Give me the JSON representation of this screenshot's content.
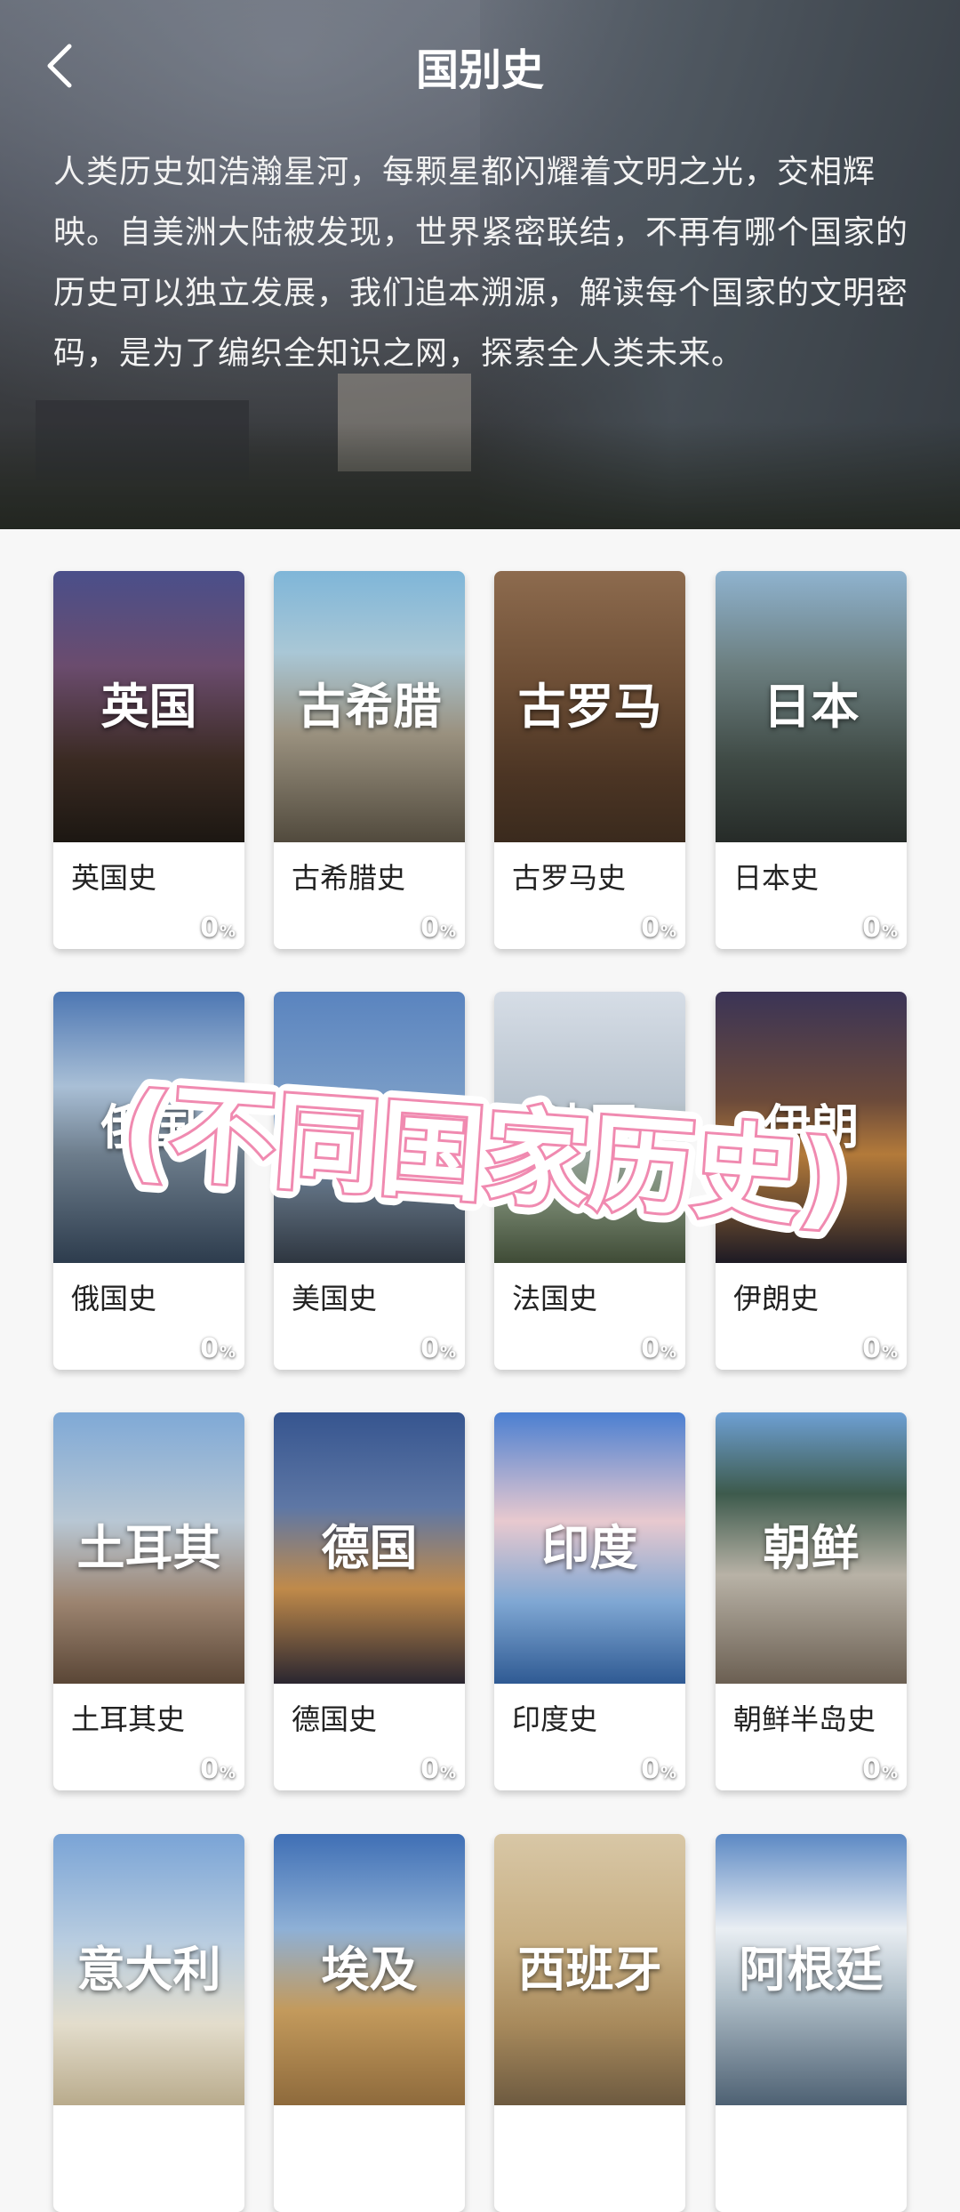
{
  "header": {
    "title": "国别史",
    "intro": "人类历史如浩瀚星河，每颗星都闪耀着文明之光，交相辉映。自美洲大陆被发现，世界紧密联结，不再有哪个国家的历史可以独立发展，我们追本溯源，解读每个国家的文明密码，是为了编织全知识之网，探索全人类未来。"
  },
  "cards": [
    {
      "img_name": "英国",
      "label": "英国史",
      "progress": "0",
      "unit": "%",
      "bg": "linear-gradient(180deg,#4a4f8a 0%,#6b4c6e 35%,#3a2a22 70%,#1c1712 100%)"
    },
    {
      "img_name": "古希腊",
      "label": "古希腊史",
      "progress": "0",
      "unit": "%",
      "bg": "linear-gradient(180deg,#7fb6d8 0%,#a9c7d6 30%,#9a917f 60%,#514a3d 100%)"
    },
    {
      "img_name": "古罗马",
      "label": "古罗马史",
      "progress": "0",
      "unit": "%",
      "bg": "linear-gradient(180deg,#8d6b4e 0%,#6e4f36 40%,#4c3524 75%,#3a2a1d 100%)"
    },
    {
      "img_name": "日本",
      "label": "日本史",
      "progress": "0",
      "unit": "%",
      "bg": "linear-gradient(180deg,#8fb3cf 0%,#6c7f80 35%,#3f4a45 70%,#262b28 100%)"
    },
    {
      "img_name": "俄国",
      "label": "俄国史",
      "progress": "0",
      "unit": "%",
      "bg": "linear-gradient(180deg,#4d77b3 0%,#a9bfd6 35%,#6d7d8c 60%,#2d3c4d 100%)"
    },
    {
      "img_name": "美国",
      "label": "美国史",
      "progress": "0",
      "unit": "%",
      "bg": "linear-gradient(180deg,#5a84bf 0%,#7ea0c8 45%,#5b6a7a 75%,#2e3640 100%)"
    },
    {
      "img_name": "法国",
      "label": "法国史",
      "progress": "0",
      "unit": "%",
      "bg": "linear-gradient(180deg,#d6dde6 0%,#b9c4cf 40%,#7a8a73 75%,#3f4b36 100%)"
    },
    {
      "img_name": "伊朗",
      "label": "伊朗史",
      "progress": "0",
      "unit": "%",
      "bg": "linear-gradient(180deg,#3b3456 0%,#6b4a3a 40%,#b37a3a 60%,#1d1a24 100%)"
    },
    {
      "img_name": "土耳其",
      "label": "土耳其史",
      "progress": "0",
      "unit": "%",
      "bg": "linear-gradient(180deg,#7fa9d6 0%,#b8c7d4 40%,#9c8470 70%,#5a4636 100%)"
    },
    {
      "img_name": "德国",
      "label": "德国史",
      "progress": "0",
      "unit": "%",
      "bg": "linear-gradient(180deg,#36558f 0%,#5e77a5 35%,#c08a4a 65%,#2a2630 100%)"
    },
    {
      "img_name": "印度",
      "label": "印度史",
      "progress": "0",
      "unit": "%",
      "bg": "linear-gradient(180deg,#4b7fd1 0%,#e8c9cf 40%,#7fa7d3 70%,#2f5a93 100%)"
    },
    {
      "img_name": "朝鲜",
      "label": "朝鲜半岛史",
      "progress": "0",
      "unit": "%",
      "bg": "linear-gradient(180deg,#6ea0d4 0%,#3d5a4c 30%,#b8b2a6 60%,#6b5f52 100%)"
    },
    {
      "img_name": "意大利",
      "label": "",
      "progress": "",
      "unit": "",
      "bg": "linear-gradient(180deg,#7aa4d6 0%,#b9cde0 40%,#e3ddcc 70%,#b9ab8c 100%)"
    },
    {
      "img_name": "埃及",
      "label": "",
      "progress": "",
      "unit": "",
      "bg": "linear-gradient(180deg,#3f6fb5 0%,#8eb0d6 35%,#c39a5c 65%,#8e6a3c 100%)"
    },
    {
      "img_name": "西班牙",
      "label": "",
      "progress": "",
      "unit": "",
      "bg": "linear-gradient(180deg,#d8c7a6 0%,#c7ae82 40%,#a88a5c 70%,#6d5a40 100%)"
    },
    {
      "img_name": "阿根廷",
      "label": "",
      "progress": "",
      "unit": "",
      "bg": "linear-gradient(180deg,#5c89c4 0%,#e9eef3 35%,#aebdc7 60%,#4e6173 100%)"
    }
  ],
  "overlay_caption": "(不同国家历史)",
  "colors": {
    "overlay_fill": "#ffffff",
    "overlay_stroke": "#f08ab0"
  }
}
